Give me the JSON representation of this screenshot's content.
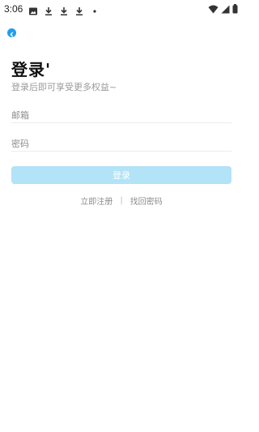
{
  "status_bar": {
    "time": "3:06",
    "left_icons": [
      "image-icon",
      "download-icon",
      "download-icon",
      "download-icon",
      "dot-icon"
    ],
    "right_icons": [
      "wifi-icon",
      "signal-icon",
      "battery-icon"
    ]
  },
  "header": {
    "back_icon": "chevron-left-icon",
    "accent_color": "#1f9ef0"
  },
  "page": {
    "title": "登录'",
    "subtitle": "登录后即可享受更多权益~"
  },
  "form": {
    "email_placeholder": "邮箱",
    "email_value": "",
    "password_placeholder": "密码",
    "password_value": "",
    "login_label": "登录",
    "login_color": "#b2e3f7"
  },
  "links": {
    "register": "立即注册",
    "separator": "|",
    "forgot": "找回密码"
  }
}
